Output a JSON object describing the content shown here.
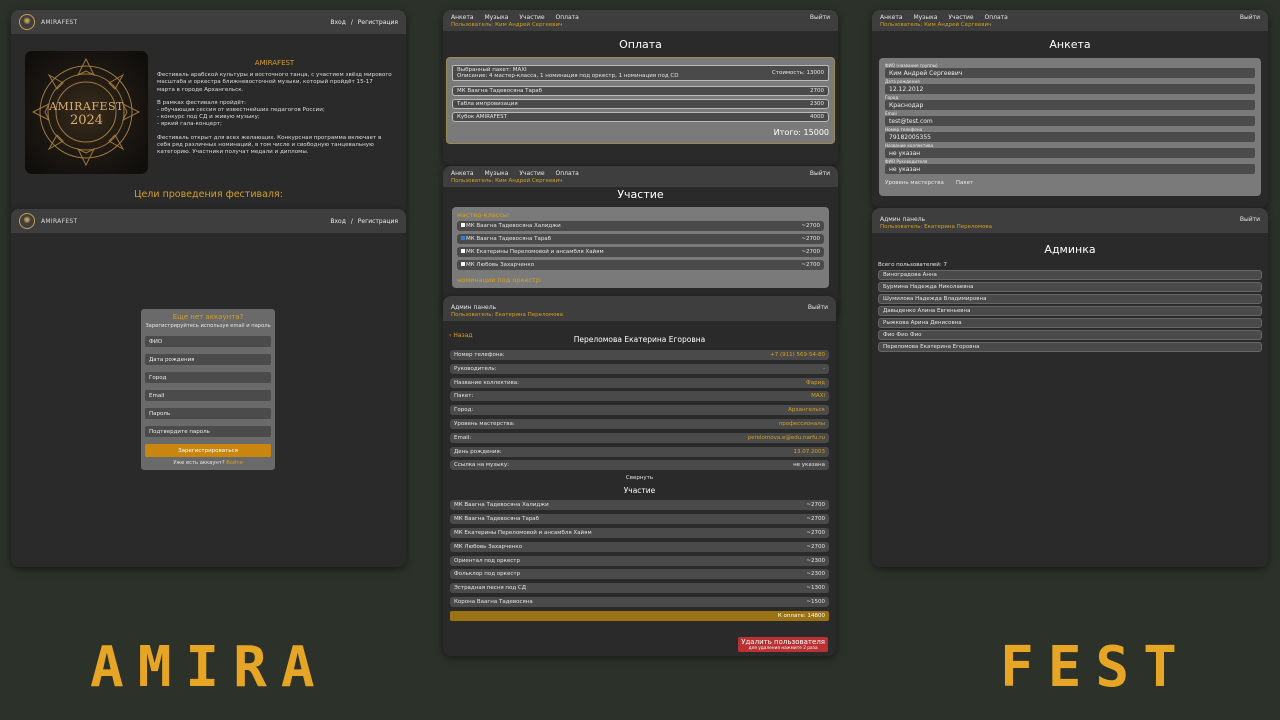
{
  "colors": {
    "background": "#2c3129",
    "accent": "#d4a020",
    "danger": "#b83232",
    "panel": "#2a2a2a"
  },
  "landing": {
    "brand": "AMIRAFEST",
    "nav": {
      "login": "Вход",
      "separator": "/",
      "register": "Регистрация"
    },
    "poster": {
      "title": "AMIRAFEST",
      "year": "2024"
    },
    "heading": "AMIRAFEST",
    "intro": "Фестиваль арабской культуры и восточного танца, с участием звёзд мирового масштаба и оркестра ближневосточной музыки, который пройдёт 15-17 марта в городе Архангельск.",
    "program_title": "В рамках фестиваля пройдёт:",
    "program": [
      "- обучающая сессия от известнейших педагогов России;",
      "- конкурс под СД и живую музыку;",
      "- яркий гала-концерт;"
    ],
    "open_text": "Фестиваль открыт для всех желающих. Конкурсная программа включает в себя ряд различных номинаций, в том числе и свободную танцевальную категорию. Участники получат медали и дипломы.",
    "goals": "Цели проведения фестиваля:"
  },
  "register": {
    "brand": "AMIRAFEST",
    "nav": {
      "login": "Вход",
      "separator": "/",
      "register": "Регистрация"
    },
    "title": "Еще нет аккаунта?",
    "subtitle": "Зарегистрируйтесь используя email и пароль",
    "fields": [
      "ФИО",
      "Дата рождения",
      "Город",
      "Email",
      "Пароль",
      "Подтвердите пароль"
    ],
    "submit": "Зарегистрироваться",
    "has_account": "Уже есть аккаунт?",
    "login_link": "Войти"
  },
  "payment": {
    "nav": [
      "Анкета",
      "Музыка",
      "Участие",
      "Оплата"
    ],
    "logout": "Выйти",
    "user": "Пользователь: Ким Андрей Сергеевич",
    "title": "Оплата",
    "package_line": "Выбранный пакет: MAXI",
    "package_desc": "Описание: 4 мастер-класса, 1 номинация под оркестр, 1 номинация под СD",
    "package_cost": "Стоимость: 13000",
    "items": [
      {
        "name": "МК Ваагна Тадевосяна Тараб",
        "price": "2700"
      },
      {
        "name": "Табла импровизация",
        "price": "2300"
      },
      {
        "name": "Кубок AMIRAFEST",
        "price": "4000"
      }
    ],
    "total": "Итого: 15000"
  },
  "participation": {
    "nav": [
      "Анкета",
      "Музыка",
      "Участие",
      "Оплата"
    ],
    "logout": "Выйти",
    "user": "Пользователь: Ким Андрей Сергеевич",
    "title": "Участие",
    "group1": "мастер-классы:",
    "items": [
      {
        "name": "МК Ваагна Тадевосяна Халиджи",
        "price": "~2700",
        "checked": false
      },
      {
        "name": "МК Ваагна Тадевосяна Тараб",
        "price": "~2700",
        "checked": true
      },
      {
        "name": "МК Екатерины Переломовой и ансамбля Хайям",
        "price": "~2700",
        "checked": false
      },
      {
        "name": "МК Любовь Захарченко",
        "price": "~2700",
        "checked": false
      }
    ],
    "group2": "номинации под оркестр:"
  },
  "profile": {
    "nav": [
      "Анкета",
      "Музыка",
      "Участие",
      "Оплата"
    ],
    "logout": "Выйти",
    "user": "Пользователь: Ким Андрей Сергеевич",
    "title": "Анкета",
    "fields": [
      {
        "label": "ФИО (название группы)",
        "value": "Ким Андрей Сергеевич"
      },
      {
        "label": "Дата рождения",
        "value": "12.12.2012"
      },
      {
        "label": "Город",
        "value": "Краснодар"
      },
      {
        "label": "Email",
        "value": "test@test.com"
      },
      {
        "label": "Номер телефона",
        "value": "79182005355"
      },
      {
        "label": "Название коллектива",
        "value": "не указан"
      },
      {
        "label": "ФИО Руководителя",
        "value": "не указан"
      }
    ],
    "tail_left": "Уровень мастерства",
    "tail_right": "Пакет"
  },
  "admin_list": {
    "nav": "Админ панель",
    "logout": "Выйти",
    "user": "Пользователь: Екатерина Переломова",
    "title": "Админка",
    "count": "Всего пользователей: 7",
    "users": [
      "Виноградова Анна",
      "Бурмина Надежда Николаевна",
      "Шумилова Надежда Владимировна",
      "Давыденко Алина Евгеньевна",
      "Рыжкова Арина Денисовна",
      "Фио Фио Фио",
      "Переломова Екатерина Егоровна"
    ]
  },
  "admin_detail": {
    "nav": "Админ панель",
    "logout": "Выйти",
    "user": "Пользователь: Екатерина Переломова",
    "back": "Назад",
    "name": "Переломова Екатерина Егоровна",
    "rows": [
      {
        "label": "Номер телефона:",
        "value": "+7 (911) 569-54-80"
      },
      {
        "label": "Руководитель:",
        "value": "-"
      },
      {
        "label": "Название коллектива:",
        "value": "Фарид"
      },
      {
        "label": "Пакет:",
        "value": "MAXI"
      },
      {
        "label": "Город:",
        "value": "Архангельск"
      },
      {
        "label": "Уровень мастерства:",
        "value": "профессионалы"
      },
      {
        "label": "Email:",
        "value": "perelomova.e@edu.narfu.ru"
      },
      {
        "label": "День рождения:",
        "value": "13.07.2003"
      },
      {
        "label": "Ссылка на музыку:",
        "value": "не указана"
      }
    ],
    "collapse": "Свернуть",
    "participation_title": "Участие",
    "items": [
      {
        "name": "МК Ваагна Тадевосяна Халиджи",
        "price": "~2700"
      },
      {
        "name": "МК Ваагна Тадевосяна Тараб",
        "price": "~2700"
      },
      {
        "name": "МК Екатерины Переломовой и ансамбля Хайям",
        "price": "~2700"
      },
      {
        "name": "МК Любовь Захарченко",
        "price": "~2700"
      },
      {
        "name": "Ориентал под оркестр",
        "price": "~2300"
      },
      {
        "name": "Фольклор под оркестр",
        "price": "~2300"
      },
      {
        "name": "Эстрадная песня под СД",
        "price": "~1300"
      },
      {
        "name": "Корона Ваагна Тадевосяна",
        "price": "~1500"
      }
    ],
    "to_pay": "К оплате: 14800",
    "delete": "Удалить пользователя",
    "delete_hint": "для удаления нажмите 2 раза"
  },
  "footer": {
    "left": "AMIRA",
    "right": "FEST"
  }
}
